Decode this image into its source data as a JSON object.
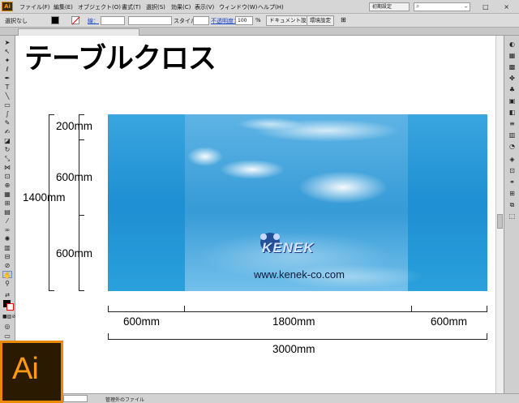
{
  "menubar": {
    "app_icon": "Ai",
    "items": [
      "ファイル(F)",
      "編集(E)",
      "オブジェクト(O)",
      "書式(T)",
      "選択(S)",
      "効果(C)",
      "表示(V)",
      "ウィンドウ(W)",
      "ヘルプ(H)"
    ],
    "workspace": "初期設定",
    "window_controls": "– □ ×"
  },
  "controlbar": {
    "selection_state": "選択なし",
    "stroke_label": "線：",
    "style_label": "スタイル：",
    "opacity_label": "不透明度：",
    "opacity_value": "100",
    "opacity_unit": "%",
    "doc_setup_button": "ドキュメント設定",
    "prefs_button": "環境設定"
  },
  "statusbar": {
    "file_state": "管理外のファイル"
  },
  "document": {
    "title": "テーブルクロス",
    "vertical_dims": [
      "200mm",
      "600mm",
      "600mm"
    ],
    "total_height": "1400mm",
    "horizontal_dims": [
      "600mm",
      "1800mm",
      "600mm"
    ],
    "total_width": "3000mm",
    "brand_logo": "KENEK",
    "url": "www.kenek-co.com"
  },
  "colors": {
    "sky": "#1c95d6",
    "ai_orange": "#ff9a10",
    "ai_bg": "#2b1a02"
  }
}
